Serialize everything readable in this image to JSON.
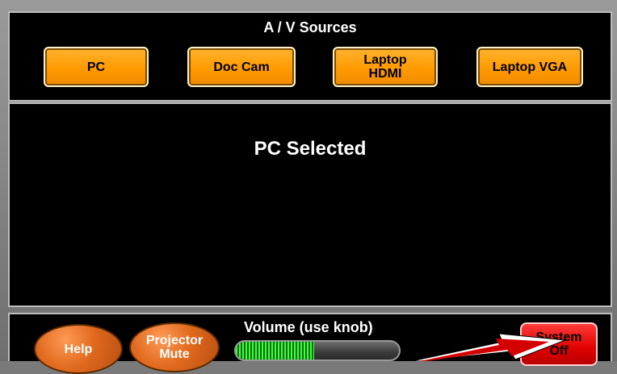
{
  "top": {
    "title": "A / V Sources",
    "buttons": [
      {
        "label": "PC"
      },
      {
        "label": "Doc Cam"
      },
      {
        "label": "Laptop\nHDMI"
      },
      {
        "label": "Laptop VGA"
      }
    ]
  },
  "main": {
    "status": "PC Selected"
  },
  "bottom": {
    "help": "Help",
    "projector_mute": "Projector\nMute",
    "volume_label": "Volume (use knob)",
    "volume_level": 0.48,
    "system_off": "System\nOff"
  },
  "colors": {
    "panel_bg": "#000000",
    "source_button": "#ff9a00",
    "oval_button": "#e06a1e",
    "system_button": "#e00000",
    "volume_fill": "#3dff3d"
  }
}
